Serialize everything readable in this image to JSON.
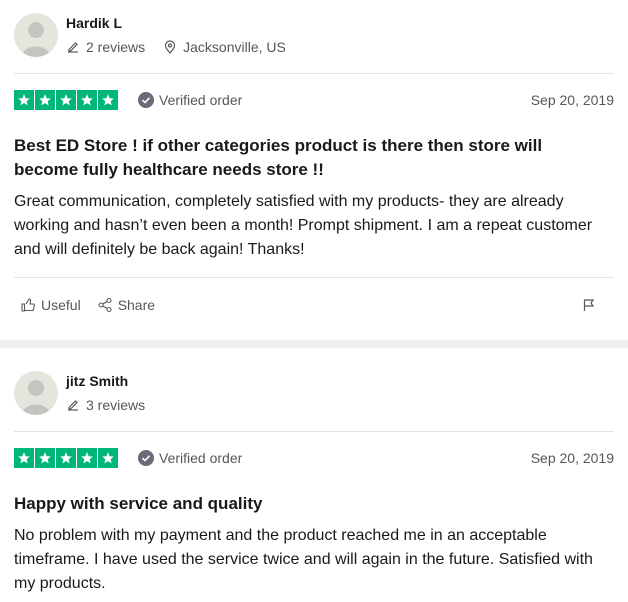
{
  "colors": {
    "star_green": "#00b67a",
    "muted_text": "#575757",
    "divider": "#e5e5dd"
  },
  "reviews": [
    {
      "reviewer_name": "Hardik L",
      "review_count": "2 reviews",
      "location": "Jacksonville, US",
      "rating_stars": 5,
      "verified_label": "Verified order",
      "date": "Sep 20, 2019",
      "title": "Best ED Store ! if other categories product is there then store will become fully healthcare needs store !!",
      "body": "Great communication, completely satisfied with my products- they are already working and hasn’t even been a month! Prompt shipment. I am a repeat customer and will definitely be back again! Thanks!",
      "actions": {
        "useful_label": "Useful",
        "share_label": "Share"
      }
    },
    {
      "reviewer_name": "jitz Smith",
      "review_count": "3 reviews",
      "rating_stars": 5,
      "verified_label": "Verified order",
      "date": "Sep 20, 2019",
      "title": "Happy with service and quality",
      "body": "No problem with my payment and the product reached me in an acceptable timeframe. I have used the service twice and will again in the future. Satisfied with my products."
    }
  ]
}
